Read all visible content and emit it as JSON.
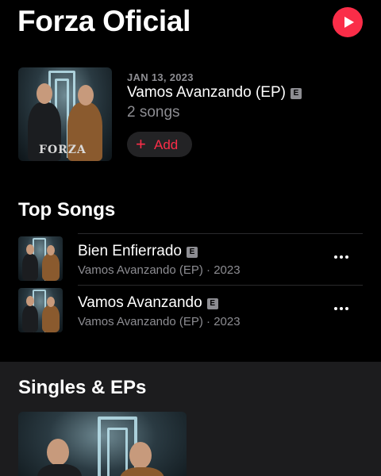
{
  "artist": {
    "name": "Forza Oficial"
  },
  "latest_release": {
    "date": "JAN 13, 2023",
    "title": "Vamos Avanzando (EP)",
    "explicit": "E",
    "song_count": "2 songs",
    "add_label": "Add",
    "add_icon": "+",
    "cover_logo": "FORZA"
  },
  "top_songs": {
    "title": "Top Songs",
    "items": [
      {
        "title": "Bien Enfierrado",
        "explicit": "E",
        "subtitle": "Vamos Avanzando (EP) · 2023"
      },
      {
        "title": "Vamos Avanzando",
        "explicit": "E",
        "subtitle": "Vamos Avanzando (EP) · 2023"
      }
    ]
  },
  "singles": {
    "title": "Singles & EPs"
  },
  "colors": {
    "accent": "#fa2d48",
    "secondary_text": "#8d8d92",
    "background": "#000000",
    "section_bg": "#1c1c1e"
  }
}
